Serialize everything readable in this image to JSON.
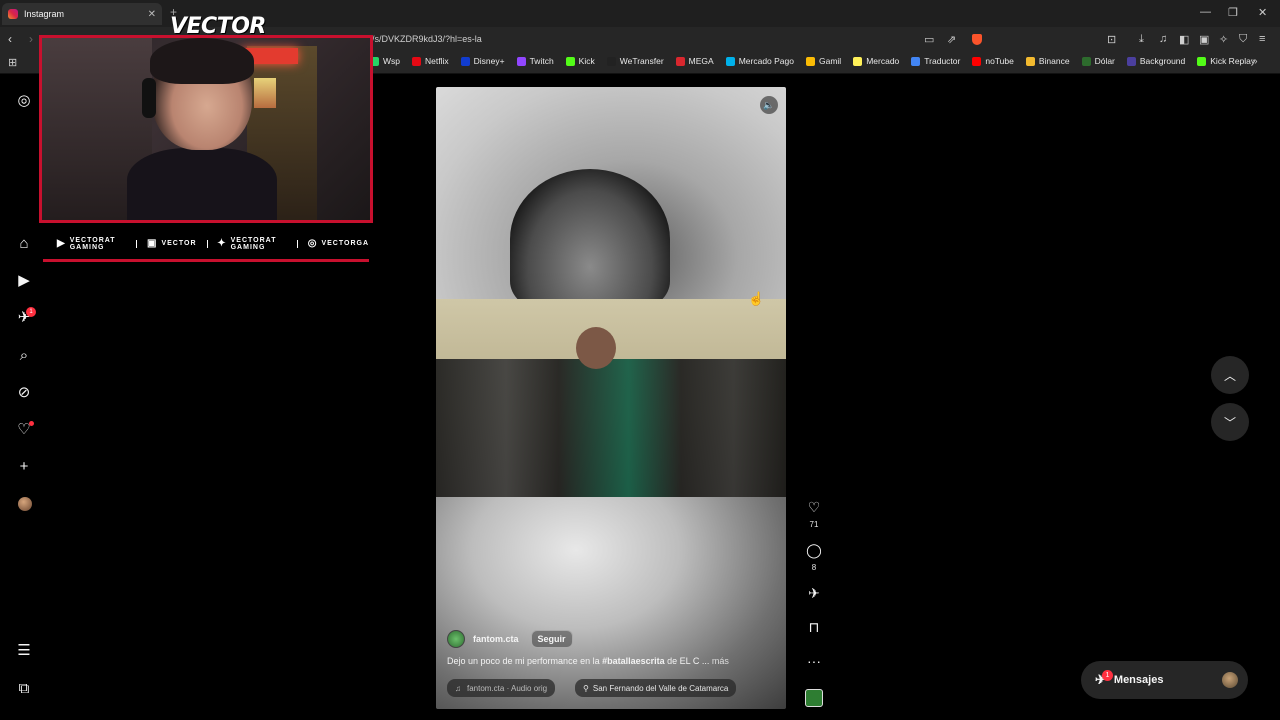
{
  "browser": {
    "tab_title": "Instagram",
    "tab_close": "✕",
    "new_tab": "+",
    "url": "/s/DVKZDR9kdJ3/?hl=es-la",
    "window_controls": [
      "—",
      "❐",
      "✕"
    ],
    "bookmarks": [
      {
        "label": "Wsp",
        "color": "#25d366"
      },
      {
        "label": "Netflix",
        "color": "#e50914"
      },
      {
        "label": "Disney+",
        "color": "#113ccf"
      },
      {
        "label": "Twitch",
        "color": "#9146ff"
      },
      {
        "label": "Kick",
        "color": "#53fc18"
      },
      {
        "label": "WeTransfer",
        "color": "#222222"
      },
      {
        "label": "MEGA",
        "color": "#d9272e"
      },
      {
        "label": "Mercado Pago",
        "color": "#00b1ea"
      },
      {
        "label": "Gamil",
        "color": "#fbbc05"
      },
      {
        "label": "Mercado",
        "color": "#fff159"
      },
      {
        "label": "Traductor",
        "color": "#4285f4"
      },
      {
        "label": "noTube",
        "color": "#ff0000"
      },
      {
        "label": "Binance",
        "color": "#f3ba2f"
      },
      {
        "label": "Dólar",
        "color": "#2d6b2d"
      },
      {
        "label": "Background",
        "color": "#4b3f9e"
      },
      {
        "label": "Kick Replay",
        "color": "#53fc18"
      }
    ],
    "bookmarks_more": "»"
  },
  "overlay": {
    "brand": "VECTOR",
    "socials": [
      {
        "icon": "▶",
        "name": "youtube-icon",
        "label": "VECTORAT GAMING"
      },
      {
        "icon": "▣",
        "name": "twitch-icon",
        "label": "VECTOR"
      },
      {
        "icon": "✦",
        "name": "twitter-icon",
        "label": "VECTORAT GAMING"
      },
      {
        "icon": "◎",
        "name": "instagram-icon",
        "label": "VECTORGA"
      }
    ]
  },
  "sidebar": {
    "notifications_badge": "1"
  },
  "reel": {
    "username": "fantom.cta",
    "follow_label": "Seguir",
    "caption_prefix": "Dejo un poco de mi performance en la ",
    "caption_hashtag": "#batallaescrita",
    "caption_suffix": " de EL C ... ",
    "caption_more": "más",
    "audio": "fantom.cta · Audio orig",
    "location": "San Fernando del Valle de Catamarca",
    "likes": "71",
    "comments": "8"
  },
  "messages": {
    "label": "Mensajes",
    "badge": "1"
  },
  "colors": {
    "accent_red": "#c8102e",
    "notification": "#ff3040",
    "background": "#000000"
  }
}
